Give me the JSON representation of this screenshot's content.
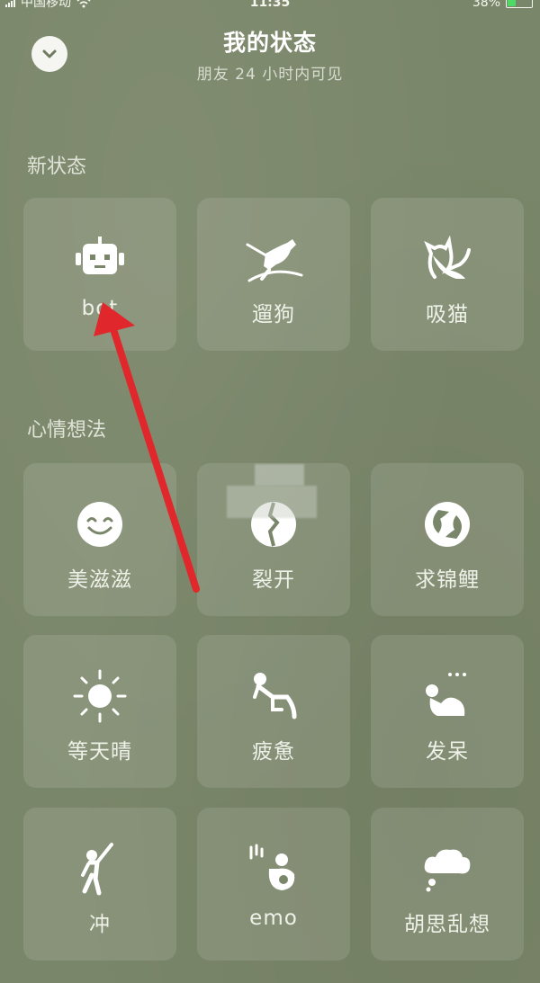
{
  "status_bar": {
    "carrier": "中国移动",
    "time": "11:35",
    "battery_percent": "38%",
    "battery_level": 0.38
  },
  "header": {
    "title": "我的状态",
    "subtitle": "朋友 24 小时内可见"
  },
  "sections": [
    {
      "label": "新状态",
      "items": [
        {
          "label": "bot",
          "icon": "robot-icon"
        },
        {
          "label": "遛狗",
          "icon": "dog-walking-icon"
        },
        {
          "label": "吸猫",
          "icon": "cat-icon"
        }
      ]
    },
    {
      "label": "心情想法",
      "items": [
        {
          "label": "美滋滋",
          "icon": "smile-icon"
        },
        {
          "label": "裂开",
          "icon": "cracked-icon"
        },
        {
          "label": "求锦鲤",
          "icon": "koi-icon"
        },
        {
          "label": "等天晴",
          "icon": "sun-icon"
        },
        {
          "label": "疲惫",
          "icon": "tired-person-icon"
        },
        {
          "label": "发呆",
          "icon": "daydream-icon"
        },
        {
          "label": "冲",
          "icon": "cheer-person-icon"
        },
        {
          "label": "emo",
          "icon": "emo-person-icon"
        },
        {
          "label": "胡思乱想",
          "icon": "thought-cloud-icon"
        }
      ]
    }
  ],
  "colors": {
    "background": "#7a8669",
    "tile": "rgba(255,255,255,0.11)",
    "annotation_arrow": "#e0282c"
  }
}
